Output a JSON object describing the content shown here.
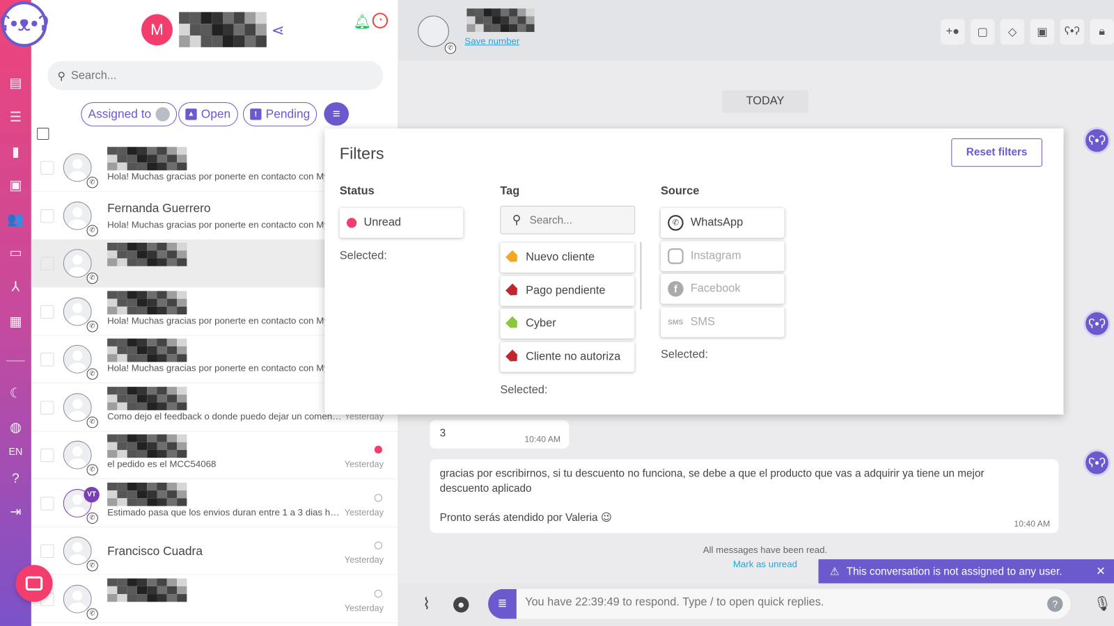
{
  "sidebar": {
    "logo": "bear-logo",
    "items": [
      "conversations-icon",
      "filter-icon",
      "reports-icon",
      "contacts-card-icon",
      "team-icon",
      "messages-icon",
      "integrations-icon",
      "table-icon",
      "moon-icon",
      "globe-icon",
      "help-icon",
      "logout-icon"
    ],
    "language": "EN"
  },
  "list": {
    "avatar_initial": "M",
    "search_placeholder": "Search...",
    "chips": {
      "assigned": "Assigned to",
      "open": "Open",
      "pending": "Pending"
    },
    "rows": [
      {
        "name": "",
        "preview": "Hola! Muchas gracias por ponerte en contacto con My",
        "time": "",
        "status": "none",
        "badge": ""
      },
      {
        "name": "Fernanda Guerrero",
        "preview": "Hola! Muchas gracias por ponerte en contacto con My",
        "time": "",
        "status": "none",
        "badge": ""
      },
      {
        "name": "",
        "preview": "",
        "time": "",
        "status": "none",
        "badge": ""
      },
      {
        "name": "",
        "preview": "Hola! Muchas gracias por ponerte en contacto con My",
        "time": "",
        "status": "none",
        "badge": ""
      },
      {
        "name": "",
        "preview": "Hola! Muchas gracias por ponerte en contacto con My",
        "time": "",
        "status": "none",
        "badge": ""
      },
      {
        "name": "",
        "preview": "Como dejo el feedback o donde puedo dejar un coment...",
        "time": "Yesterday",
        "status": "none",
        "badge": ""
      },
      {
        "name": "",
        "preview": "el pedido es el MCC54068",
        "time": "Yesterday",
        "status": "unread",
        "badge": ""
      },
      {
        "name": "",
        "preview": "Estimado pasa que los envios duran entre 1 a 3 dias ha...",
        "time": "Yesterday",
        "status": "open",
        "badge": "VT"
      },
      {
        "name": "Francisco Cuadra",
        "preview": "",
        "time": "Yesterday",
        "status": "open",
        "badge": ""
      },
      {
        "name": "",
        "preview": "",
        "time": "Yesterday",
        "status": "open",
        "badge": ""
      }
    ]
  },
  "chat": {
    "save_number": "Save number",
    "header_actions": [
      "add-contact-icon",
      "note-icon",
      "tag-icon",
      "archive-icon",
      "bot-icon",
      "lock-icon"
    ],
    "day_label": "TODAY",
    "messages": [
      {
        "text": "3",
        "time": "10:40 AM"
      },
      {
        "text": "gracias por escribirnos, si tu descuento no funciona, se debe a que el producto que vas a adquirir ya tiene un mejor descuento aplicado",
        "text2": "Pronto serás atendido por Valeria 😉",
        "time": "10:40 AM"
      }
    ],
    "read_notice": "All messages have been read.",
    "mark_unread": "Mark as unread",
    "warning": "This conversation is not assigned to any user.",
    "input_placeholder": "You have 22:39:49 to respond. Type / to open quick replies."
  },
  "filters": {
    "title": "Filters",
    "reset": "Reset filters",
    "status": {
      "heading": "Status",
      "options": [
        "Unread"
      ],
      "selected": "Selected:"
    },
    "tag": {
      "heading": "Tag",
      "search_placeholder": "Search...",
      "options": [
        {
          "label": "Nuevo cliente",
          "color": "#f5a623"
        },
        {
          "label": "Pago pendiente",
          "color": "#c0262d"
        },
        {
          "label": "Cyber",
          "color": "#8cc63f"
        },
        {
          "label": "Cliente no autoriza",
          "color": "#c0262d"
        }
      ],
      "selected": "Selected:"
    },
    "source": {
      "heading": "Source",
      "options": [
        "WhatsApp",
        "Instagram",
        "Facebook",
        "SMS"
      ],
      "sms_icon": "SMS",
      "selected": "Selected:"
    }
  },
  "colors": {
    "accent": "#6b5acd",
    "pink": "#f23d6d",
    "unread": "#f23d6d",
    "notify": "#22c55e",
    "clock": "#ef4444"
  }
}
